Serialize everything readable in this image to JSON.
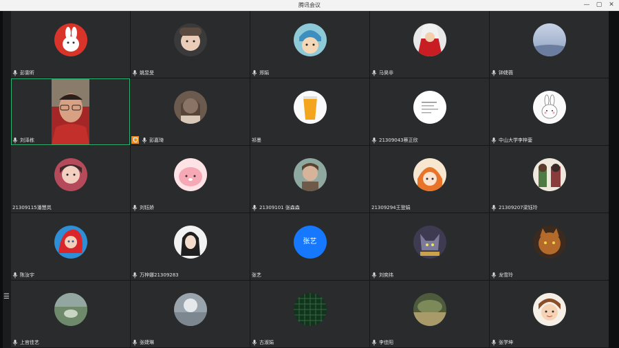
{
  "window": {
    "title": "腾讯会议"
  },
  "controls": {
    "minimize": "—",
    "maximize": "▢",
    "close": "✕"
  },
  "participants": [
    {
      "name": "彭雯昕",
      "mic": true
    },
    {
      "name": "姚昱旻",
      "mic": true
    },
    {
      "name": "郑娟",
      "mic": true
    },
    {
      "name": "马昊非",
      "mic": true
    },
    {
      "name": "钟婕薇",
      "mic": true
    },
    {
      "name": "刘泽栋",
      "mic": true,
      "video": true
    },
    {
      "name": "彭嘉琦",
      "mic": true,
      "badge": "shield"
    },
    {
      "name": "祁墨",
      "mic": false
    },
    {
      "name": "21309043蔡正欣",
      "mic": true
    },
    {
      "name": "中山大学李梓蓥",
      "mic": true
    },
    {
      "name": "21309115潘慧岚",
      "mic": false
    },
    {
      "name": "刘钰娇",
      "mic": true
    },
    {
      "name": "21309101 张森森",
      "mic": true
    },
    {
      "name": "21309294王登娟",
      "mic": false
    },
    {
      "name": "21309207梁钰玲",
      "mic": true
    },
    {
      "name": "陈汝宇",
      "mic": true
    },
    {
      "name": "万梓娜21309283",
      "mic": true
    },
    {
      "name": "张艺",
      "mic": false,
      "text_avatar": "张艺"
    },
    {
      "name": "刘奕纬",
      "mic": true
    },
    {
      "name": "龙雪玲",
      "mic": true
    },
    {
      "name": "上官佳艺",
      "mic": true
    },
    {
      "name": "张婕琳",
      "mic": true
    },
    {
      "name": "古淑娟",
      "mic": true
    },
    {
      "name": "李佳阳",
      "mic": true
    },
    {
      "name": "张学坤",
      "mic": true
    }
  ]
}
